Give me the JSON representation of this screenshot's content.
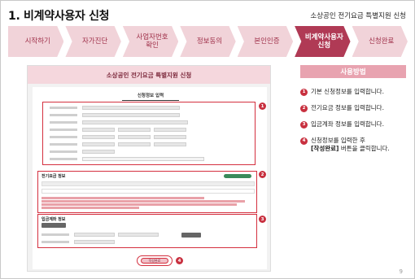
{
  "header": {
    "title": "1. 비계약사용자 신청",
    "subtitle": "소상공인 전기요금 특별지원 신청"
  },
  "steps": [
    {
      "label": "시작하기"
    },
    {
      "label": "자가진단"
    },
    {
      "label": "사업자번호\n확인"
    },
    {
      "label": "정보동의"
    },
    {
      "label": "본인인증"
    },
    {
      "label": "비계약사용자\n신청",
      "active": true
    },
    {
      "label": "신청완료"
    }
  ],
  "screenshot": {
    "banner": "소상공인 전기요금 특별지원 신청",
    "card_title": "신청정보 입력",
    "section_electric": "전기요금 정보",
    "section_bank": "입금계좌 정보",
    "submit_label": "작성완료",
    "badges": [
      "1",
      "2",
      "3",
      "4"
    ]
  },
  "panel": {
    "heading": "사용방법",
    "items": [
      {
        "num": "1",
        "text": "기본 신청정보를 입력합니다."
      },
      {
        "num": "2",
        "text": "전기요금 정보를 입력합니다."
      },
      {
        "num": "3",
        "text": "입금계좌 정보를 입력합니다."
      },
      {
        "num": "4",
        "text_pre": "신청정보를 입력한 후",
        "text_bold": "[작성완료]",
        "text_post": " 버튼을 클릭합니다."
      }
    ]
  },
  "page_number": "9"
}
